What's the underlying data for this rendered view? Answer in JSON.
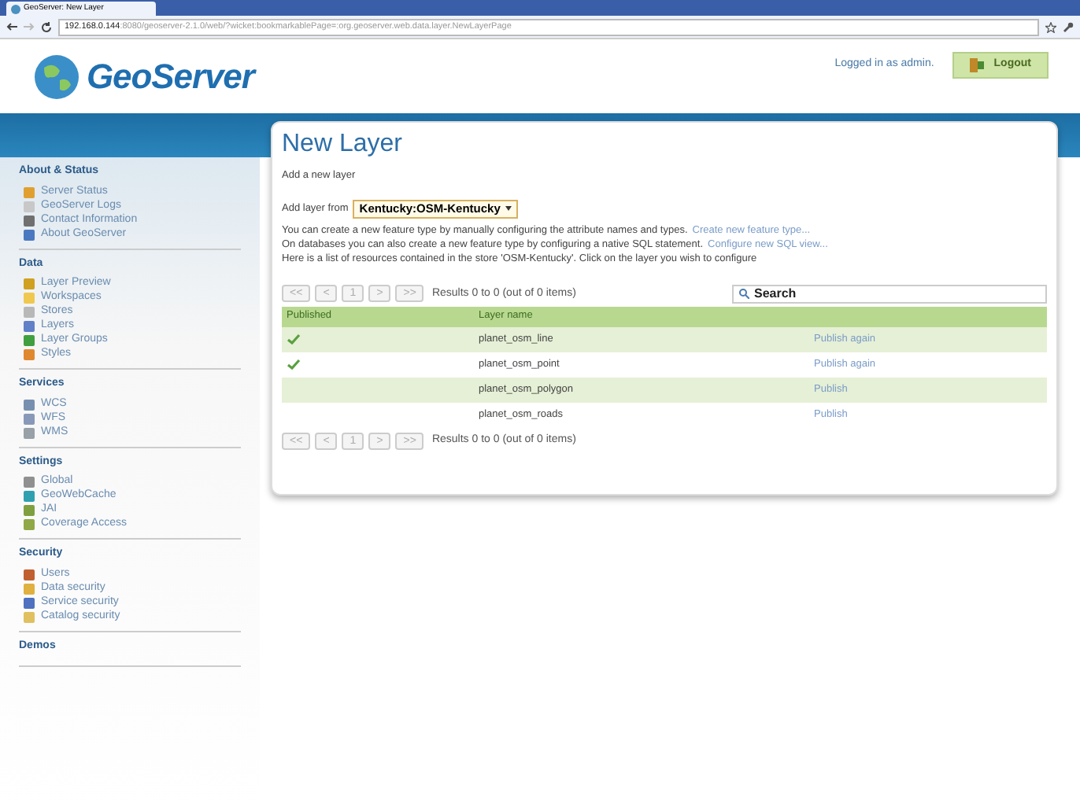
{
  "browser": {
    "tab_title": "GeoServer: New Layer",
    "address_host": "192.168.0.144",
    "address_path": ":8080/geoserver-2.1.0/web/?wicket:bookmarkablePage=:org.geoserver.web.data.layer.NewLayerPage"
  },
  "header": {
    "logo_text": "GeoServer",
    "login_status": "Logged in as admin.",
    "logout_label": "Logout"
  },
  "sidebar": [
    {
      "title": "About & Status",
      "items": [
        {
          "label": "Server Status",
          "color": "#e0a030"
        },
        {
          "label": "GeoServer Logs",
          "color": "#c8c8c8"
        },
        {
          "label": "Contact Information",
          "color": "#707070"
        },
        {
          "label": "About GeoServer",
          "color": "#4a78c0"
        }
      ]
    },
    {
      "title": "Data",
      "items": [
        {
          "label": "Layer Preview",
          "color": "#d0a020"
        },
        {
          "label": "Workspaces",
          "color": "#f0c850"
        },
        {
          "label": "Stores",
          "color": "#b8b8b8"
        },
        {
          "label": "Layers",
          "color": "#6080c8"
        },
        {
          "label": "Layer Groups",
          "color": "#40a040"
        },
        {
          "label": "Styles",
          "color": "#e08830"
        }
      ]
    },
    {
      "title": "Services",
      "items": [
        {
          "label": "WCS",
          "color": "#7890b0"
        },
        {
          "label": "WFS",
          "color": "#8898b8"
        },
        {
          "label": "WMS",
          "color": "#98a0a8"
        }
      ]
    },
    {
      "title": "Settings",
      "items": [
        {
          "label": "Global",
          "color": "#909090"
        },
        {
          "label": "GeoWebCache",
          "color": "#30a0b0"
        },
        {
          "label": "JAI",
          "color": "#80a040"
        },
        {
          "label": "Coverage Access",
          "color": "#90a848"
        }
      ]
    },
    {
      "title": "Security",
      "items": [
        {
          "label": "Users",
          "color": "#c06030"
        },
        {
          "label": "Data security",
          "color": "#e0b040"
        },
        {
          "label": "Service security",
          "color": "#5070c0"
        },
        {
          "label": "Catalog security",
          "color": "#e0c060"
        }
      ]
    },
    {
      "title": "Demos"
    }
  ],
  "content": {
    "title": "New Layer",
    "subtitle": "Add a new layer",
    "add_from_label": "Add layer from",
    "store_select": "Kentucky:OSM-Kentucky",
    "lines": [
      {
        "text": "You can create a new feature type by manually configuring the attribute names and types.",
        "link": "Create new feature type..."
      },
      {
        "text": "On databases you can also create a new feature type by configuring a native SQL statement.",
        "link": "Configure new SQL view..."
      },
      {
        "text": "Here is a list of resources contained in the store 'OSM-Kentucky'. Click on the layer you wish to configure"
      }
    ],
    "pager": {
      "buttons": [
        "<<",
        "<",
        "1",
        ">",
        ">>"
      ],
      "results": "Results 0 to 0 (out of 0 items)"
    },
    "search": {
      "placeholder": "Search"
    },
    "table": {
      "columns": [
        "Published",
        "Layer name"
      ],
      "rows": [
        {
          "published": true,
          "name": "planet_osm_line",
          "action": "Publish again"
        },
        {
          "published": true,
          "name": "planet_osm_point",
          "action": "Publish again"
        },
        {
          "published": false,
          "name": "planet_osm_polygon",
          "action": "Publish"
        },
        {
          "published": false,
          "name": "planet_osm_roads",
          "action": "Publish"
        }
      ]
    },
    "pager_bottom": {
      "buttons": [
        "<<",
        "<",
        "1",
        ">",
        ">>"
      ],
      "results": "Results 0 to 0 (out of 0 items)"
    }
  }
}
